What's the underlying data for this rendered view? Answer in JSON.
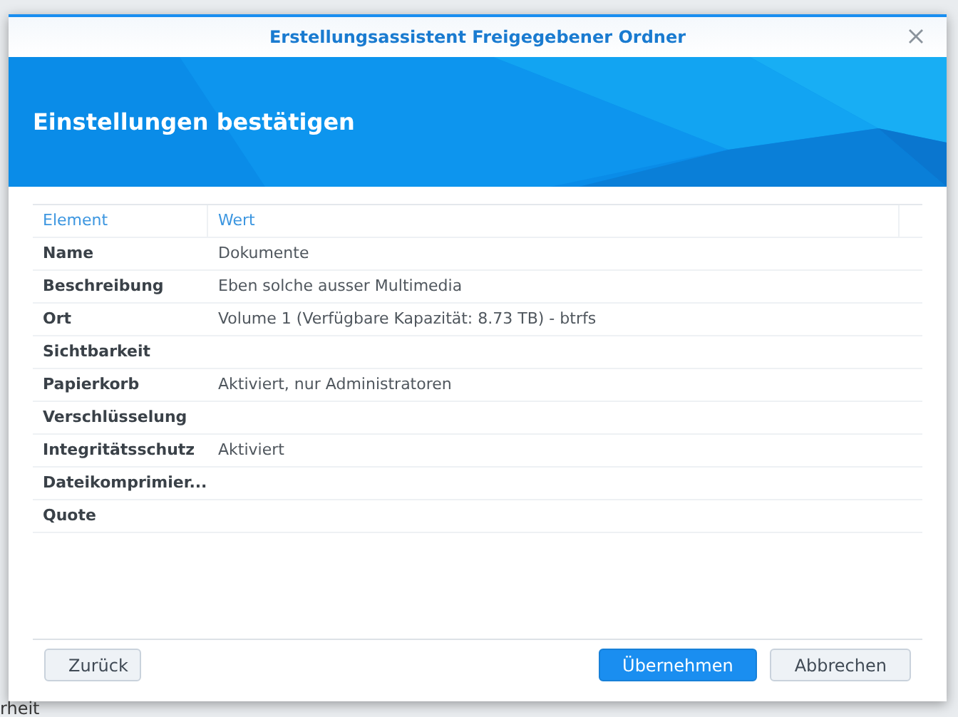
{
  "background": {
    "fragment": "rheit"
  },
  "dialog": {
    "title": "Erstellungsassistent Freigegebener Ordner",
    "heading": "Einstellungen bestätigen",
    "table": {
      "columns": [
        "Element",
        "Wert"
      ],
      "rows": [
        {
          "element": "Name",
          "value": "Dokumente"
        },
        {
          "element": "Beschreibung",
          "value": "Eben solche ausser Multimedia"
        },
        {
          "element": "Ort",
          "value": "Volume 1 (Verfügbare Kapazität: 8.73 TB) - btrfs"
        },
        {
          "element": "Sichtbarkeit"
        },
        {
          "element": "Papierkorb",
          "value": "Aktiviert, nur Administratoren"
        },
        {
          "element": "Verschlüsselung"
        },
        {
          "element": "Integritätsschutz",
          "value": "Aktiviert"
        },
        {
          "element": "Dateikomprimier..."
        },
        {
          "element": "Quote"
        }
      ]
    },
    "buttons_left": [
      {
        "label": "Zurück",
        "kind": "secondary"
      }
    ],
    "buttons_right": [
      {
        "label": "Übernehmen",
        "kind": "primary"
      },
      {
        "label": "Abbrechen",
        "kind": "secondary"
      }
    ]
  }
}
